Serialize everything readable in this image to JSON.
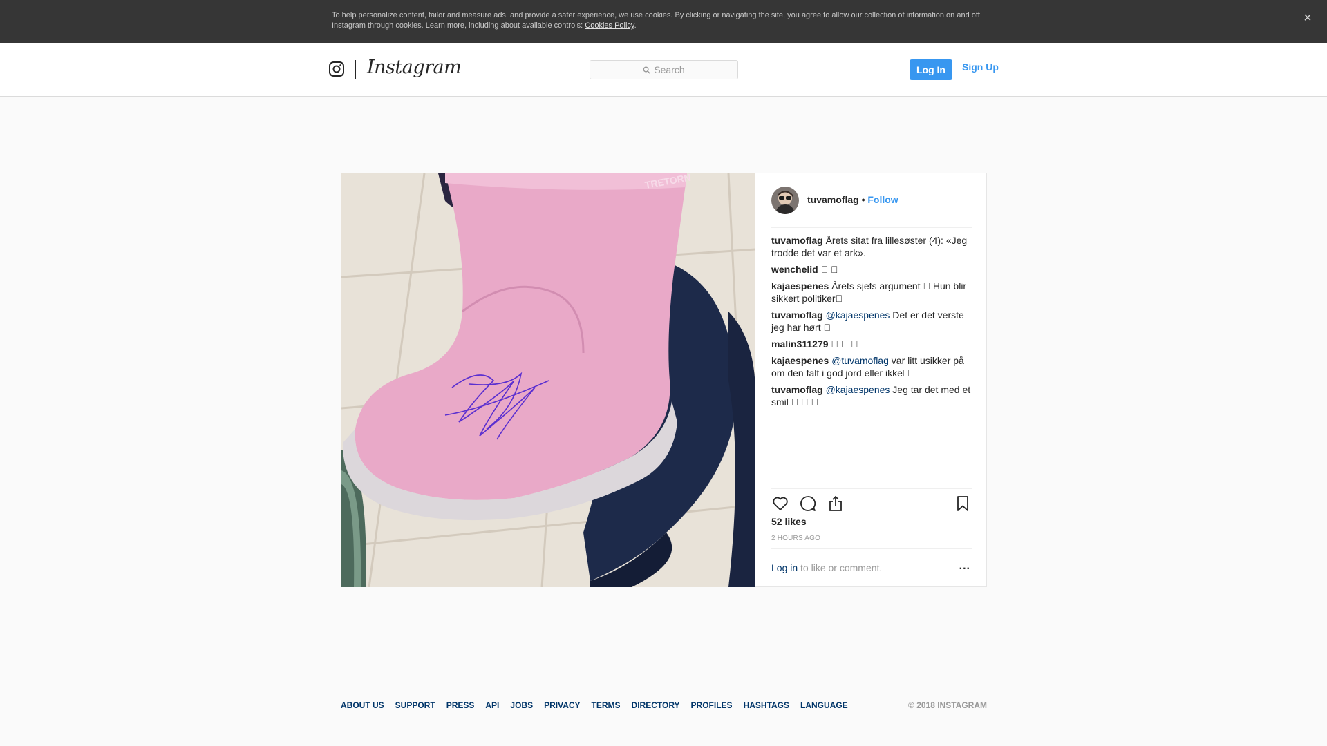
{
  "cookie_banner": {
    "text": "To help personalize content, tailor and measure ads, and provide a safer experience, we use cookies. By clicking or navigating the site, you agree to allow our collection of information on and off Instagram through cookies. Learn more, including about available controls: ",
    "link": "Cookies Policy",
    "period": ".",
    "close_icon": "×"
  },
  "nav": {
    "wordmark": "Instagram",
    "search_placeholder": "Search",
    "login_label": "Log In",
    "signup_label": "Sign Up"
  },
  "post": {
    "username": "tuvamoflag",
    "dot": " • ",
    "follow": "Follow",
    "comments": [
      {
        "user": "tuvamoflag",
        "mention": "",
        "text": " Årets sitat fra lillesøster (4): «Jeg trodde det var et ark»."
      },
      {
        "user": "wenchelid",
        "mention": "",
        "text": " \u0000 \u0000"
      },
      {
        "user": "kajaespenes",
        "mention": "",
        "text": " Årets sjefs argument \u0000  Hun blir sikkert politiker\u0000"
      },
      {
        "user": "tuvamoflag",
        "mention": "@kajaespenes",
        "text": " Det er det verste jeg har hørt \u0000"
      },
      {
        "user": "malin311279",
        "mention": "",
        "text": " \u0000 \u0000 \u0000"
      },
      {
        "user": "kajaespenes",
        "mention": "@tuvamoflag",
        "text": " var litt usikker på om den falt i god jord eller ikke\u0000"
      },
      {
        "user": "tuvamoflag",
        "mention": "@kajaespenes",
        "text": " Jeg tar det med et smil \u0000 \u0000 \u0000"
      }
    ],
    "likes": "52 likes",
    "time": "2 HOURS AGO",
    "login_link": "Log in",
    "login_suffix": " to like or comment.",
    "more": "..."
  },
  "footer": {
    "links": [
      "ABOUT US",
      "SUPPORT",
      "PRESS",
      "API",
      "JOBS",
      "PRIVACY",
      "TERMS",
      "DIRECTORY",
      "PROFILES",
      "HASHTAGS",
      "LANGUAGE"
    ],
    "copyright": "© 2018 INSTAGRAM"
  },
  "colors": {
    "accent": "#3897f0",
    "link": "#003569",
    "banner": "#363636",
    "boot_pink": "#e9a9c8",
    "boot_navy": "#1d2a4a"
  }
}
